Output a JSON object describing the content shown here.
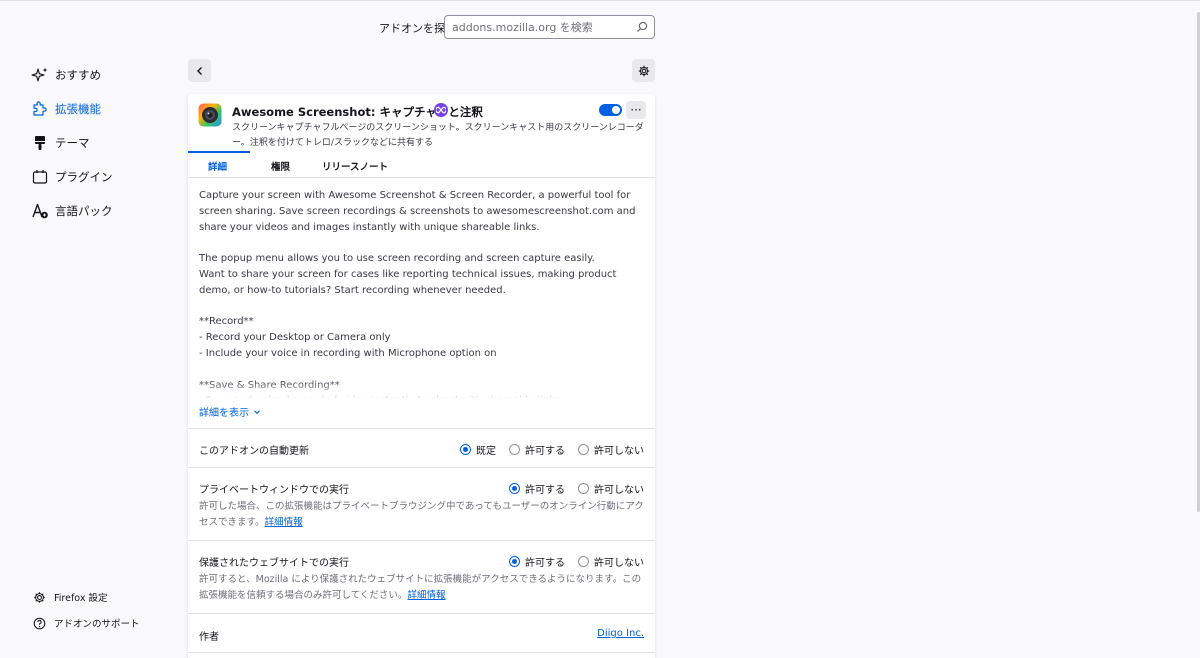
{
  "search": {
    "label": "アドオンを探す",
    "placeholder": "addons.mozilla.org を検索"
  },
  "sidebar": {
    "items": [
      {
        "label": "おすすめ",
        "icon": "sparkle-icon"
      },
      {
        "label": "拡張機能",
        "icon": "puzzle-icon",
        "active": true
      },
      {
        "label": "テーマ",
        "icon": "brush-icon"
      },
      {
        "label": "プラグイン",
        "icon": "plugin-icon"
      },
      {
        "label": "言語パック",
        "icon": "language-icon"
      }
    ],
    "bottom": [
      {
        "label": "Firefox 設定",
        "icon": "gear-icon"
      },
      {
        "label": "アドオンのサポート",
        "icon": "help-icon"
      }
    ]
  },
  "addon": {
    "name": "Awesome Screenshot: キャプチャーと注釈",
    "description": "スクリーンキャプチャフルページのスクリーンショット。スクリーンキャスト用のスクリーンレコーダー。注釈を付けてトレロ/スラックなどに共有する",
    "enabled": true,
    "more_label": "···"
  },
  "tabs": [
    {
      "label": "詳細",
      "active": true
    },
    {
      "label": "権限"
    },
    {
      "label": "リリースノート"
    }
  ],
  "details": {
    "text": "Capture your screen with Awesome Screenshot & Screen Recorder, a powerful tool for screen sharing. Save screen recordings & screenshots to awesomescreenshot.com and share your videos and images instantly with unique shareable links.\n\nThe popup menu allows you to use screen recording and screen capture easily.\nWant to share your screen for cases like reporting technical issues, making product demo, or how-to tutorials? Start recording whenever needed.\n\n**Record**\n- Record your Desktop or Camera only\n- Include your voice in recording with Microphone option on\n\n**Save & Share Recording**\n- Save and upload recorded video instantly to cloud with shareable links",
    "show_more": "詳細を表示"
  },
  "settings": {
    "auto_update": {
      "label": "このアドオンの自動更新",
      "options": [
        "既定",
        "許可する",
        "許可しない"
      ],
      "selected": 0
    },
    "private": {
      "label": "プライベートウィンドウでの実行",
      "options": [
        "許可する",
        "許可しない"
      ],
      "selected": 0,
      "note": "許可した場合、この拡張機能はプライベートブラウジング中であってもユーザーのオンライン行動にアクセスできます。",
      "link": "詳細情報"
    },
    "protected": {
      "label": "保護されたウェブサイトでの実行",
      "options": [
        "許可する",
        "許可しない"
      ],
      "selected": 0,
      "note": "許可すると、Mozilla により保護されたウェブサイトに拡張機能がアクセスできるようになります。この拡張機能を信頼する場合のみ許可してください。",
      "link": "詳細情報"
    },
    "author": {
      "label": "作者",
      "value": "Diigo Inc."
    }
  },
  "colors": {
    "accent": "#0061e0",
    "badge": "#7542e5",
    "background": "#f9f9fb"
  }
}
